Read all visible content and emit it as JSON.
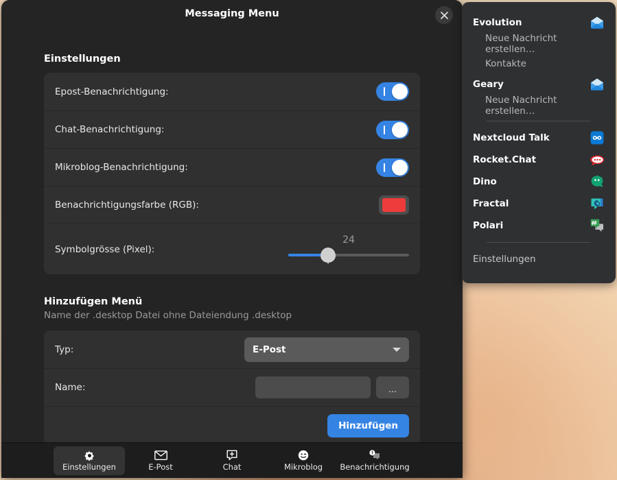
{
  "window": {
    "title": "Messaging Menu",
    "close_icon": "close-icon"
  },
  "settings": {
    "heading": "Einstellungen",
    "rows": [
      {
        "label": "Epost-Benachrichtigung:",
        "type": "switch",
        "value": "on"
      },
      {
        "label": "Chat-Benachrichtigung:",
        "type": "switch",
        "value": "on"
      },
      {
        "label": "Mikroblog-Benachrichtigung:",
        "type": "switch",
        "value": "on"
      },
      {
        "label": "Benachrichtigungsfarbe (RGB):",
        "type": "color",
        "value": "#ee3b3b"
      },
      {
        "label": "Symbolgrösse (Pixel):",
        "type": "slider",
        "value": "24",
        "percent": 33
      }
    ]
  },
  "add_menu": {
    "heading": "Hinzufügen Menü",
    "subtitle": "Name der .desktop Datei ohne Dateiendung .desktop",
    "type_label": "Typ:",
    "type_value": "E-Post",
    "name_label": "Name:",
    "name_value": "",
    "name_placeholder": "",
    "browse_label": "...",
    "add_label": "Hinzufügen"
  },
  "tabs": [
    {
      "label": "Einstellungen",
      "icon": "gear-icon",
      "active": true
    },
    {
      "label": "E-Post",
      "icon": "envelope-icon",
      "active": false
    },
    {
      "label": "Chat",
      "icon": "chat-plus-icon",
      "active": false
    },
    {
      "label": "Mikroblog",
      "icon": "smiley-wink-icon",
      "active": false
    },
    {
      "label": "Benachrichtigung",
      "icon": "notification-bubble-icon",
      "active": false
    }
  ],
  "popup": {
    "items": [
      {
        "kind": "app",
        "label": "Evolution",
        "icon": "mail-envelope-icon"
      },
      {
        "kind": "sub",
        "label": "Neue Nachricht erstellen…"
      },
      {
        "kind": "sub",
        "label": "Kontakte"
      },
      {
        "kind": "app",
        "label": "Geary",
        "icon": "mail-envelope-icon"
      },
      {
        "kind": "sub",
        "label": "Neue Nachricht erstellen…"
      },
      {
        "kind": "separator"
      },
      {
        "kind": "app",
        "label": "Nextcloud Talk",
        "icon": "nextcloud-talk-icon"
      },
      {
        "kind": "app",
        "label": "Rocket.Chat",
        "icon": "rocketchat-icon"
      },
      {
        "kind": "app",
        "label": "Dino",
        "icon": "dino-icon"
      },
      {
        "kind": "app",
        "label": "Fractal",
        "icon": "fractal-icon"
      },
      {
        "kind": "app",
        "label": "Polari",
        "icon": "polari-icon"
      },
      {
        "kind": "separator"
      },
      {
        "kind": "plain",
        "label": "Einstellungen"
      }
    ]
  },
  "colors": {
    "accent": "#3584e4",
    "notification": "#ee3b3b",
    "window_bg": "#242424",
    "group_bg": "#303030",
    "popup_bg": "#2e3032"
  }
}
